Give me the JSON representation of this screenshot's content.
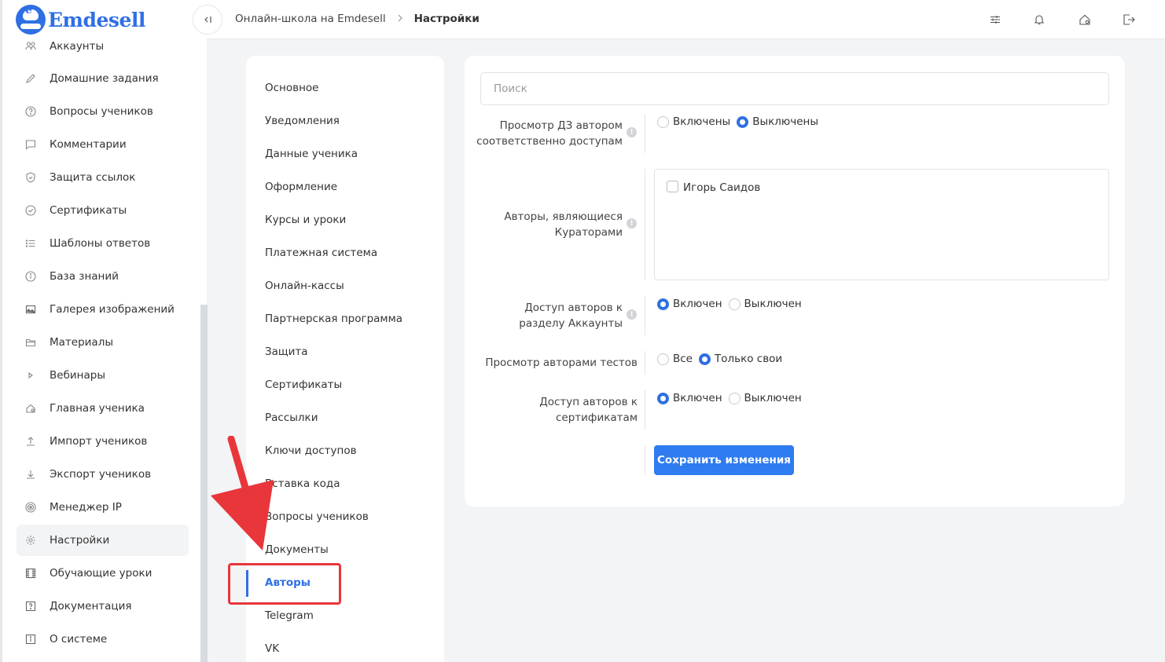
{
  "brand": {
    "name": "Emdesell",
    "logo_letter": "e",
    "accent": "#2f6fe4"
  },
  "sidebar": {
    "items": [
      {
        "label": "Аккаунты",
        "icon": "users-icon"
      },
      {
        "label": "Домашние задания",
        "icon": "pencil-icon"
      },
      {
        "label": "Вопросы учеников",
        "icon": "question-circle-icon"
      },
      {
        "label": "Комментарии",
        "icon": "comment-icon"
      },
      {
        "label": "Защита ссылок",
        "icon": "shield-icon"
      },
      {
        "label": "Сертификаты",
        "icon": "check-circle-icon"
      },
      {
        "label": "Шаблоны ответов",
        "icon": "list-icon"
      },
      {
        "label": "База знаний",
        "icon": "info-circle-icon"
      },
      {
        "label": "Галерея изображений",
        "icon": "image-icon"
      },
      {
        "label": "Материалы",
        "icon": "folder-icon"
      },
      {
        "label": "Вебинары",
        "icon": "play-icon"
      },
      {
        "label": "Главная ученика",
        "icon": "home-icon"
      },
      {
        "label": "Импорт учеников",
        "icon": "upload-icon"
      },
      {
        "label": "Экспорт учеников",
        "icon": "download-icon"
      },
      {
        "label": "Менеджер IP",
        "icon": "target-icon"
      },
      {
        "label": "Настройки",
        "icon": "gear-icon",
        "active": true
      },
      {
        "label": "Обучающие уроки",
        "icon": "film-icon"
      },
      {
        "label": "Документация",
        "icon": "help-box-icon"
      },
      {
        "label": "О системе",
        "icon": "info-box-icon"
      }
    ]
  },
  "header": {
    "collapse_icon": "collapse-left-icon",
    "breadcrumb_root": "Онлайн-школа на Emdesell",
    "breadcrumb_sep": ">",
    "breadcrumb_current": "Настройки",
    "icons": [
      "sliders-icon",
      "bell-icon",
      "home-gear-icon",
      "logout-icon"
    ]
  },
  "settings_menu": {
    "items": [
      {
        "label": "Основное"
      },
      {
        "label": "Уведомления"
      },
      {
        "label": "Данные ученика"
      },
      {
        "label": "Оформление"
      },
      {
        "label": "Курсы и уроки"
      },
      {
        "label": "Платежная система"
      },
      {
        "label": "Онлайн-кассы"
      },
      {
        "label": "Партнерская программа"
      },
      {
        "label": "Защита"
      },
      {
        "label": "Сертификаты"
      },
      {
        "label": "Рассылки"
      },
      {
        "label": "Ключи доступов"
      },
      {
        "label": "Вставка кода"
      },
      {
        "label": "Вопросы учеников"
      },
      {
        "label": "Документы"
      },
      {
        "label": "Авторы",
        "active": true
      },
      {
        "label": "Telegram"
      },
      {
        "label": "VK"
      }
    ]
  },
  "form": {
    "search_placeholder": "Поиск",
    "hw_view": {
      "label_line1": "Просмотр ДЗ автором",
      "label_line2": "соответственно доступам",
      "options": [
        "Включены",
        "Выключены"
      ],
      "selected": "Выключены"
    },
    "curators": {
      "label_line1": "Авторы, являющиеся",
      "label_line2": "Кураторами",
      "authors": [
        {
          "name": "Игорь Саидов",
          "checked": false
        }
      ]
    },
    "accounts_access": {
      "label_line1": "Доступ авторов к",
      "label_line2": "разделу Аккаунты",
      "options": [
        "Включен",
        "Выключен"
      ],
      "selected": "Включен"
    },
    "tests_view": {
      "label": "Просмотр авторами тестов",
      "options": [
        "Все",
        "Только свои"
      ],
      "selected": "Только свои"
    },
    "certs_access": {
      "label_line1": "Доступ авторов к",
      "label_line2": "сертификатам",
      "options": [
        "Включен",
        "Выключен"
      ],
      "selected": "Включен"
    },
    "info_glyph": "!",
    "save_label": "Сохранить изменения"
  },
  "annotation_color": "#e8363a"
}
